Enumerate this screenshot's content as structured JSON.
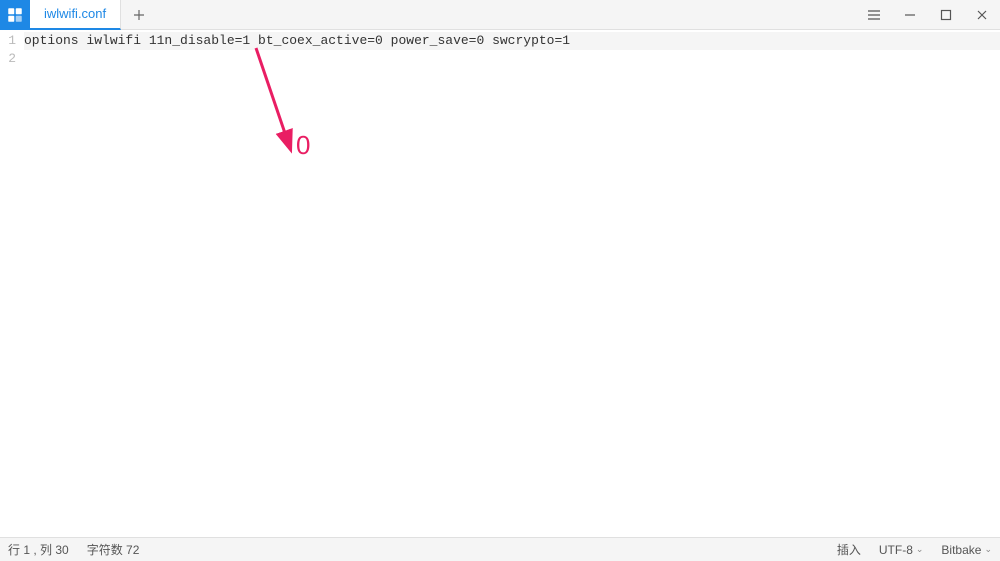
{
  "tab": {
    "title": "iwlwifi.conf"
  },
  "editor": {
    "lines": [
      {
        "num": "1",
        "text": "options iwlwifi 11n_disable=1 bt_coex_active=0 power_save=0 swcrypto=1",
        "current": true
      },
      {
        "num": "2",
        "text": "",
        "current": false
      }
    ]
  },
  "annotation": {
    "label": "0"
  },
  "status": {
    "cursor": "行 1 , 列 30",
    "chars": "字符数 72",
    "insert_mode": "插入",
    "encoding": "UTF-8",
    "language": "Bitbake"
  }
}
